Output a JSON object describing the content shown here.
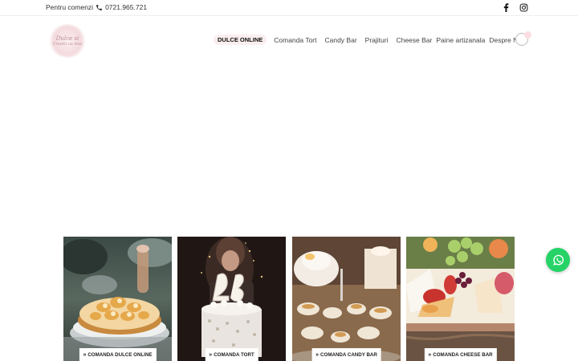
{
  "topbar": {
    "order_label": "Pentru comenzi",
    "phone": "0721.965.721",
    "social": [
      "facebook-icon",
      "instagram-icon"
    ]
  },
  "logo": {
    "line1": "Dulce si",
    "line2": "Creatii cu Ana"
  },
  "nav": {
    "items": [
      {
        "label": "DULCE ONLINE",
        "active": true
      },
      {
        "label": "Comanda Tort"
      },
      {
        "label": "Candy Bar"
      },
      {
        "label": "Prajituri"
      },
      {
        "label": "Cheese Bar"
      },
      {
        "label": "Paine artizanala"
      },
      {
        "label": "Despre Noi"
      }
    ]
  },
  "cards": [
    {
      "label": "COMANDA DULCE ONLINE"
    },
    {
      "label": "COMANDA TORT"
    },
    {
      "label": "COMANDA CANDY BAR"
    },
    {
      "label": "COMANDA CHEESE BAR"
    }
  ],
  "colors": {
    "whatsapp": "#25d366",
    "active_nav_bg": "#fbeeee"
  }
}
